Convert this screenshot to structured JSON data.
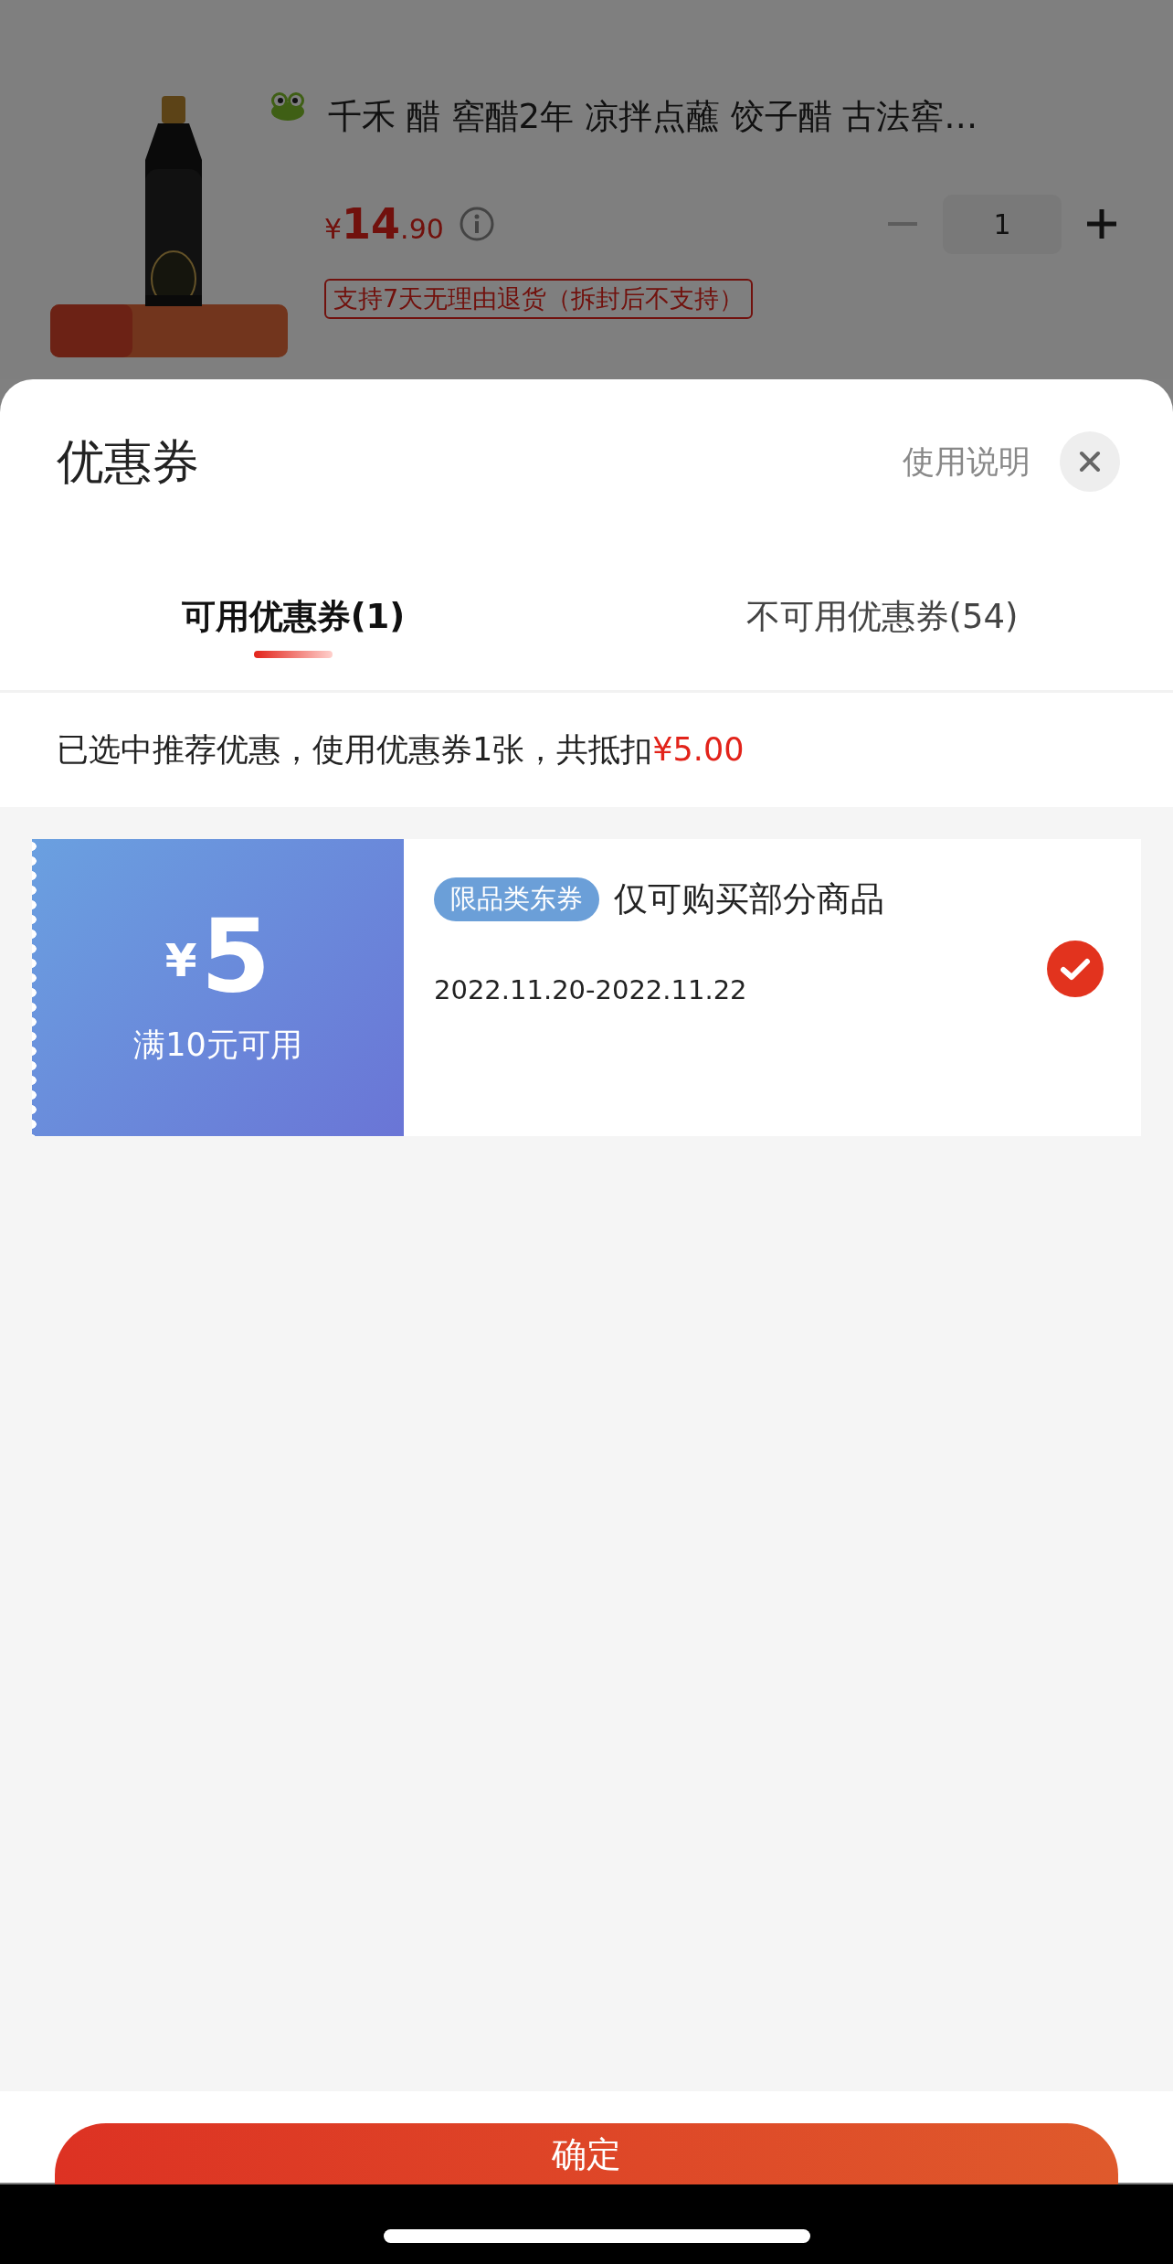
{
  "product": {
    "title": "千禾 醋 窖醋2年 凉拌点蘸 饺子醋 古法窖…",
    "price_symbol": "¥",
    "price_integer": "14",
    "price_decimal": ".90",
    "quantity": "1",
    "return_policy": "支持7天无理由退货（拆封后不支持）"
  },
  "sheet": {
    "title": "优惠券",
    "help_link": "使用说明"
  },
  "tabs": [
    {
      "label": "可用优惠券(1)",
      "selected": true
    },
    {
      "label": "不可用优惠券(54)",
      "selected": false
    }
  ],
  "summary": {
    "text": "已选中推荐优惠，使用优惠券1张，共抵扣",
    "amount": "¥5.00"
  },
  "coupons": [
    {
      "currency": "¥",
      "amount": "5",
      "condition": "满10元可用",
      "tag": "限品类东券",
      "description": "仅可购买部分商品",
      "validity": "2022.11.20-2022.11.22",
      "selected": true
    }
  ],
  "confirm_button": "确定"
}
